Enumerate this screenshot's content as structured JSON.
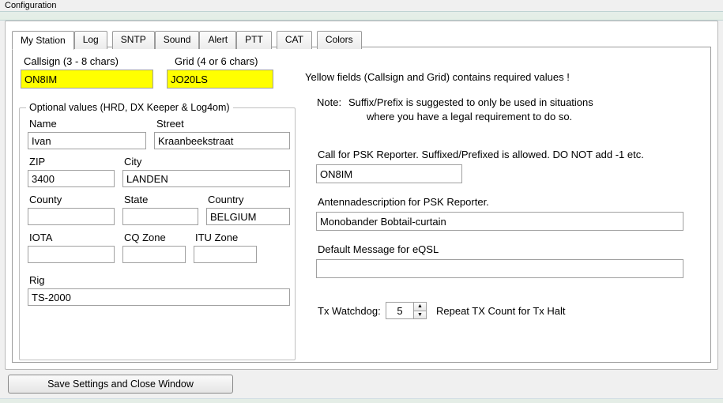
{
  "window": {
    "title": "Configuration"
  },
  "tabs": {
    "items": [
      "My Station",
      "Log",
      "SNTP",
      "Sound",
      "Alert",
      "PTT",
      "CAT",
      "Colors"
    ],
    "active": 0
  },
  "labels": {
    "callsign": "Callsign (3 - 8 chars)",
    "grid": "Grid (4 or 6 chars)",
    "yellow_msg": "Yellow fields (Callsign and Grid) contains required values !",
    "note_prefix": "Note:",
    "note_line1": "Suffix/Prefix is suggested to only be used in situations",
    "note_line2": "where you have a legal requirement to do so.",
    "psk_call": "Call for PSK Reporter. Suffixed/Prefixed is allowed. DO NOT add -1 etc.",
    "antenna_desc": "Antennadescription for PSK Reporter.",
    "eqsl_msg": "Default Message for eQSL",
    "tx_watchdog": "Tx Watchdog:",
    "repeat_tx": "Repeat TX Count for Tx Halt",
    "optional_group": "Optional values (HRD, DX Keeper & Log4om)",
    "name": "Name",
    "street": "Street",
    "zip": "ZIP",
    "city": "City",
    "county": "County",
    "state": "State",
    "country": "Country",
    "iota": "IOTA",
    "cqzone": "CQ Zone",
    "ituzone": "ITU Zone",
    "rig": "Rig"
  },
  "values": {
    "callsign": "ON8IM",
    "grid": "JO20LS",
    "name": "Ivan",
    "street": "Kraanbeekstraat",
    "zip": "3400",
    "city": "LANDEN",
    "county": "",
    "state": "",
    "country": "BELGIUM",
    "iota": "",
    "cqzone": "",
    "ituzone": "",
    "rig": "TS-2000",
    "psk_call": "ON8IM",
    "antenna": "Monobander Bobtail-curtain",
    "eqsl_msg": "",
    "tx_watchdog": "5"
  },
  "buttons": {
    "save": "Save Settings and Close Window"
  }
}
